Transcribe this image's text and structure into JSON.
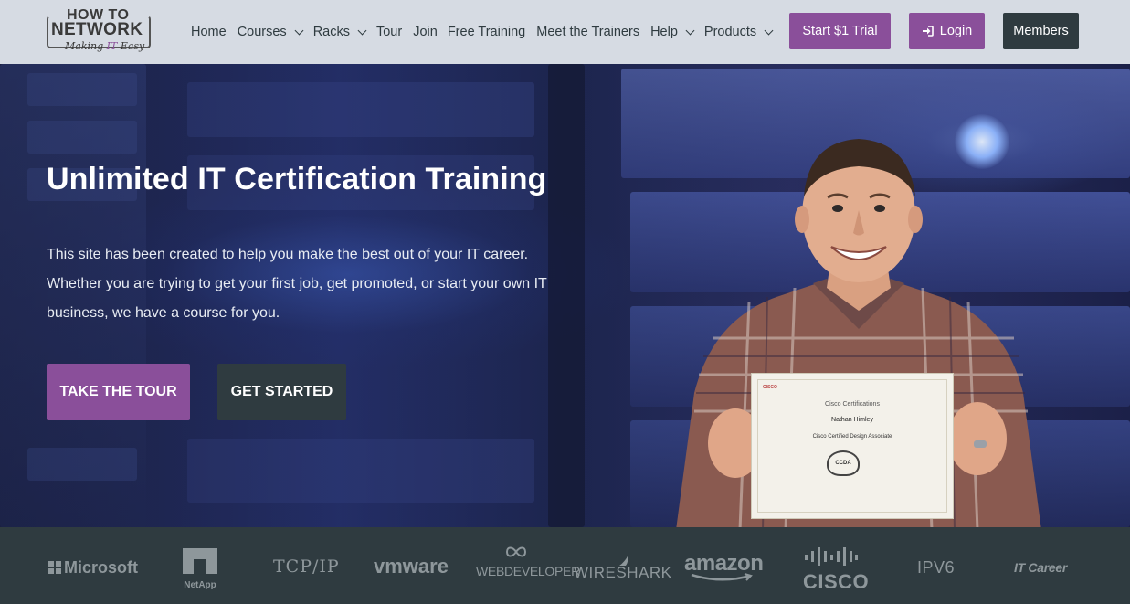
{
  "logo": {
    "line1": "HOW TO",
    "line2": "NETWORK",
    "tagline_prefix": "Making ",
    "tagline_highlight": "IT",
    "tagline_suffix": " Easy"
  },
  "nav": {
    "items": [
      {
        "label": "Home",
        "dropdown": false
      },
      {
        "label": "Courses",
        "dropdown": true
      },
      {
        "label": "Racks",
        "dropdown": true
      },
      {
        "label": "Tour",
        "dropdown": false
      },
      {
        "label": "Join",
        "dropdown": false
      },
      {
        "label": "Free Training",
        "dropdown": false
      },
      {
        "label": "Meet the Trainers",
        "dropdown": false
      },
      {
        "label": "Help",
        "dropdown": true
      },
      {
        "label": "Products",
        "dropdown": true
      }
    ],
    "trial_label": "Start $1 Trial",
    "login_label": "Login",
    "members_label": "Members"
  },
  "hero": {
    "title": "Unlimited IT Certification Training",
    "text": "This site has been created to help you make the best out of your IT career. Whether you are trying to get your first job, get promoted, or start your own IT business, we have a course for you.",
    "tour_label": "TAKE THE TOUR",
    "start_label": "GET STARTED"
  },
  "certificate": {
    "brand": "CISCO",
    "heading": "Cisco Certifications",
    "name": "Nathan Himley",
    "title": "Cisco Certified Design Associate",
    "seal": "CCDA"
  },
  "brands": [
    {
      "label": "Microsoft",
      "icon": "windows-logo"
    },
    {
      "label": "NetApp",
      "icon": "netapp-logo"
    },
    {
      "label": "TCP/IP",
      "icon": ""
    },
    {
      "label": "vmware",
      "icon": ""
    },
    {
      "label": "WEBDEVELOPER",
      "icon": "infinity-logo"
    },
    {
      "label": "WIRESHARK",
      "icon": "fin-logo"
    },
    {
      "label": "amazon",
      "icon": "smile-arrow"
    },
    {
      "label": "CISCO",
      "icon": "cisco-bars"
    },
    {
      "label": "IPV6",
      "icon": ""
    },
    {
      "label": "IT Career",
      "icon": ""
    }
  ],
  "colors": {
    "accent": "#8a4f9a",
    "dark": "#2f3b40",
    "header_bg": "#d6dbe3",
    "brand_gray": "#8e979b"
  }
}
